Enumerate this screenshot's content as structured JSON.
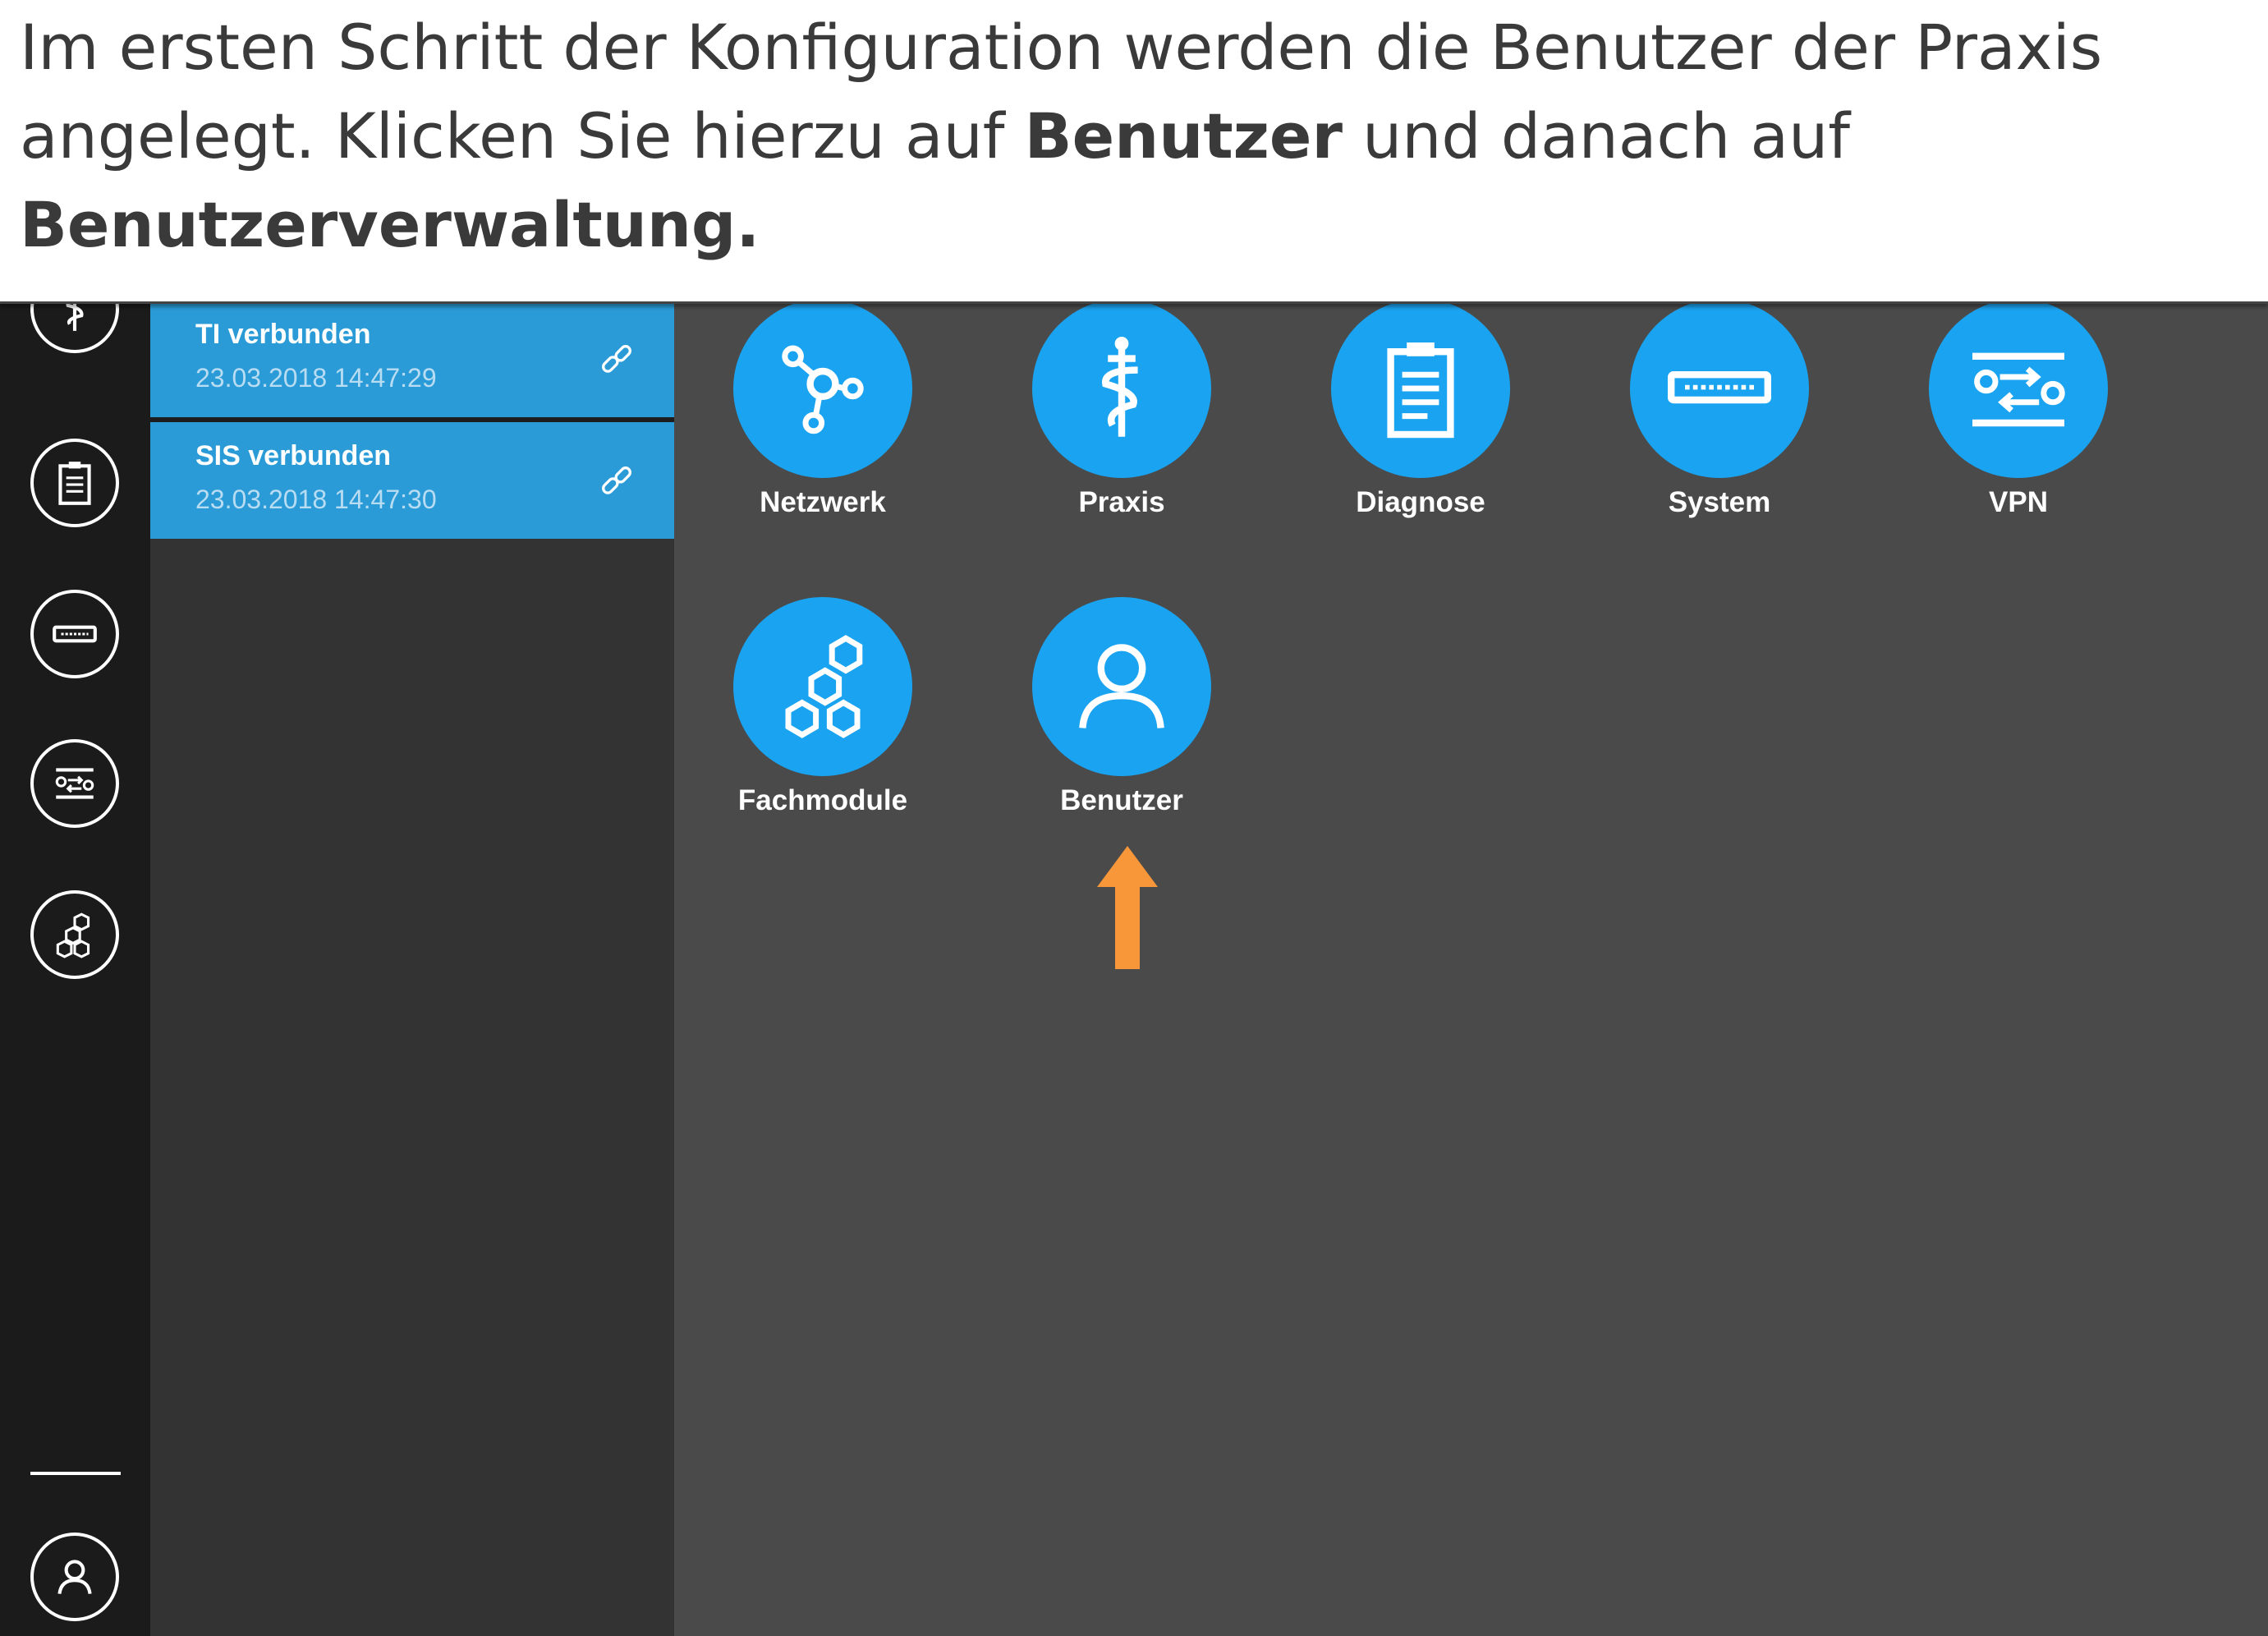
{
  "instruction": {
    "text_1": "Im ersten Schritt der Konfiguration werden die Benutzer der Praxis angelegt. Klicken Sie hierzu auf ",
    "bold_1": "Benutzer",
    "text_2": " und danach auf ",
    "bold_2": "Benutzerverwaltung."
  },
  "rail": {
    "icons": [
      "caduceus-icon",
      "clipboard-icon",
      "device-icon",
      "vpn-icon",
      "hexagons-icon"
    ],
    "user_icon": "user-icon"
  },
  "status": [
    {
      "title": "TI verbunden",
      "time": "23.03.2018 14:47:29",
      "icon": "link-icon"
    },
    {
      "title": "SIS verbunden",
      "time": "23.03.2018 14:47:30",
      "icon": "link-icon"
    }
  ],
  "tiles": [
    {
      "label": "Netzwerk",
      "icon": "network-icon"
    },
    {
      "label": "Praxis",
      "icon": "caduceus-icon"
    },
    {
      "label": "Diagnose",
      "icon": "clipboard-icon"
    },
    {
      "label": "System",
      "icon": "device-icon"
    },
    {
      "label": "VPN",
      "icon": "vpn-icon"
    },
    {
      "label": "Fachmodule",
      "icon": "hexagons-icon"
    },
    {
      "label": "Benutzer",
      "icon": "user-icon"
    }
  ],
  "colors": {
    "tile": "#1aa3f0",
    "status_bg": "#2a9bd7",
    "arrow": "#f7973a",
    "rail_bg": "#1b1b1b",
    "panel_bg": "#333333",
    "main_bg": "#4a4a4a"
  }
}
